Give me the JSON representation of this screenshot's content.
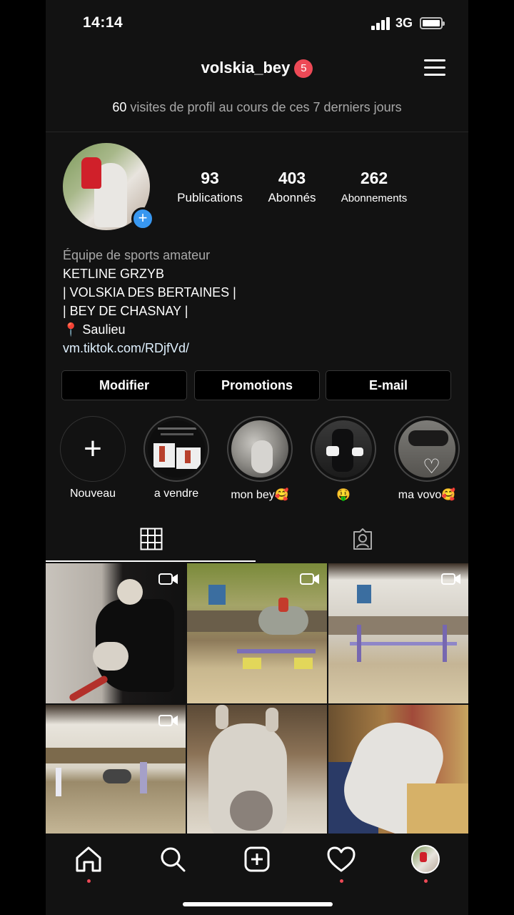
{
  "status_bar": {
    "time": "14:14",
    "network": "3G"
  },
  "header": {
    "username": "volskia_bey",
    "notification_count": "5"
  },
  "visits": {
    "count": "60",
    "text": "visites de profil au cours de ces 7 derniers jours"
  },
  "stats": [
    {
      "value": "93",
      "label": "Publications"
    },
    {
      "value": "403",
      "label": "Abonnés"
    },
    {
      "value": "262",
      "label": "Abonnements"
    }
  ],
  "bio": {
    "category": "Équipe de sports amateur",
    "lines": [
      "KETLINE GRZYB",
      "| VOLSKIA DES BERTAINES |",
      "| BEY DE CHASNAY |",
      "📍 Saulieu"
    ],
    "link": "vm.tiktok.com/RDjfVd/"
  },
  "buttons": {
    "edit": "Modifier",
    "promotions": "Promotions",
    "email": "E-mail"
  },
  "highlights": [
    {
      "label": "Nouveau",
      "icon": "plus-icon"
    },
    {
      "label": "a vendre"
    },
    {
      "label": "mon bey🥰"
    },
    {
      "label": "🤑"
    },
    {
      "label": "ma vovo🥰"
    }
  ],
  "tabs": {
    "grid_icon": "grid-icon",
    "tagged_icon": "tagged-user-icon"
  },
  "icons": {
    "nav": [
      "home-icon",
      "search-icon",
      "new-post-icon",
      "heart-icon",
      "profile-avatar"
    ],
    "video": "video-camera-icon"
  },
  "colors": {
    "background": "#121212",
    "badge": "#ed4956",
    "accent": "#3897f0"
  }
}
